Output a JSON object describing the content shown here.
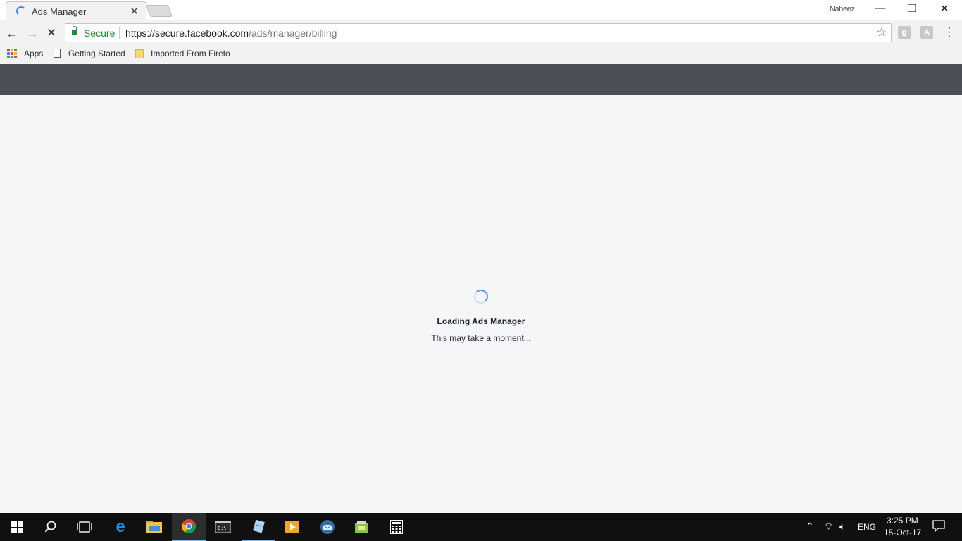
{
  "browser": {
    "tab_title": "Ads Manager",
    "profile_name": "Naheez",
    "omnibox": {
      "secure_label": "Secure",
      "url_host": "https://secure.facebook.com",
      "url_path": "/ads/manager/billing"
    },
    "bookmarks": [
      {
        "label": "Apps"
      },
      {
        "label": "Getting Started"
      },
      {
        "label": "Imported From Firefo"
      }
    ]
  },
  "page": {
    "loading_title": "Loading Ads Manager",
    "loading_subtitle": "This may take a moment..."
  },
  "taskbar": {
    "language": "ENG",
    "time": "3:25 PM",
    "date": "15-Oct-17"
  },
  "colors": {
    "fb_header": "#4b4f56",
    "page_bg": "#f5f6f7",
    "secure_green": "#1b8d3b",
    "spinner_blue": "#5890ff"
  }
}
